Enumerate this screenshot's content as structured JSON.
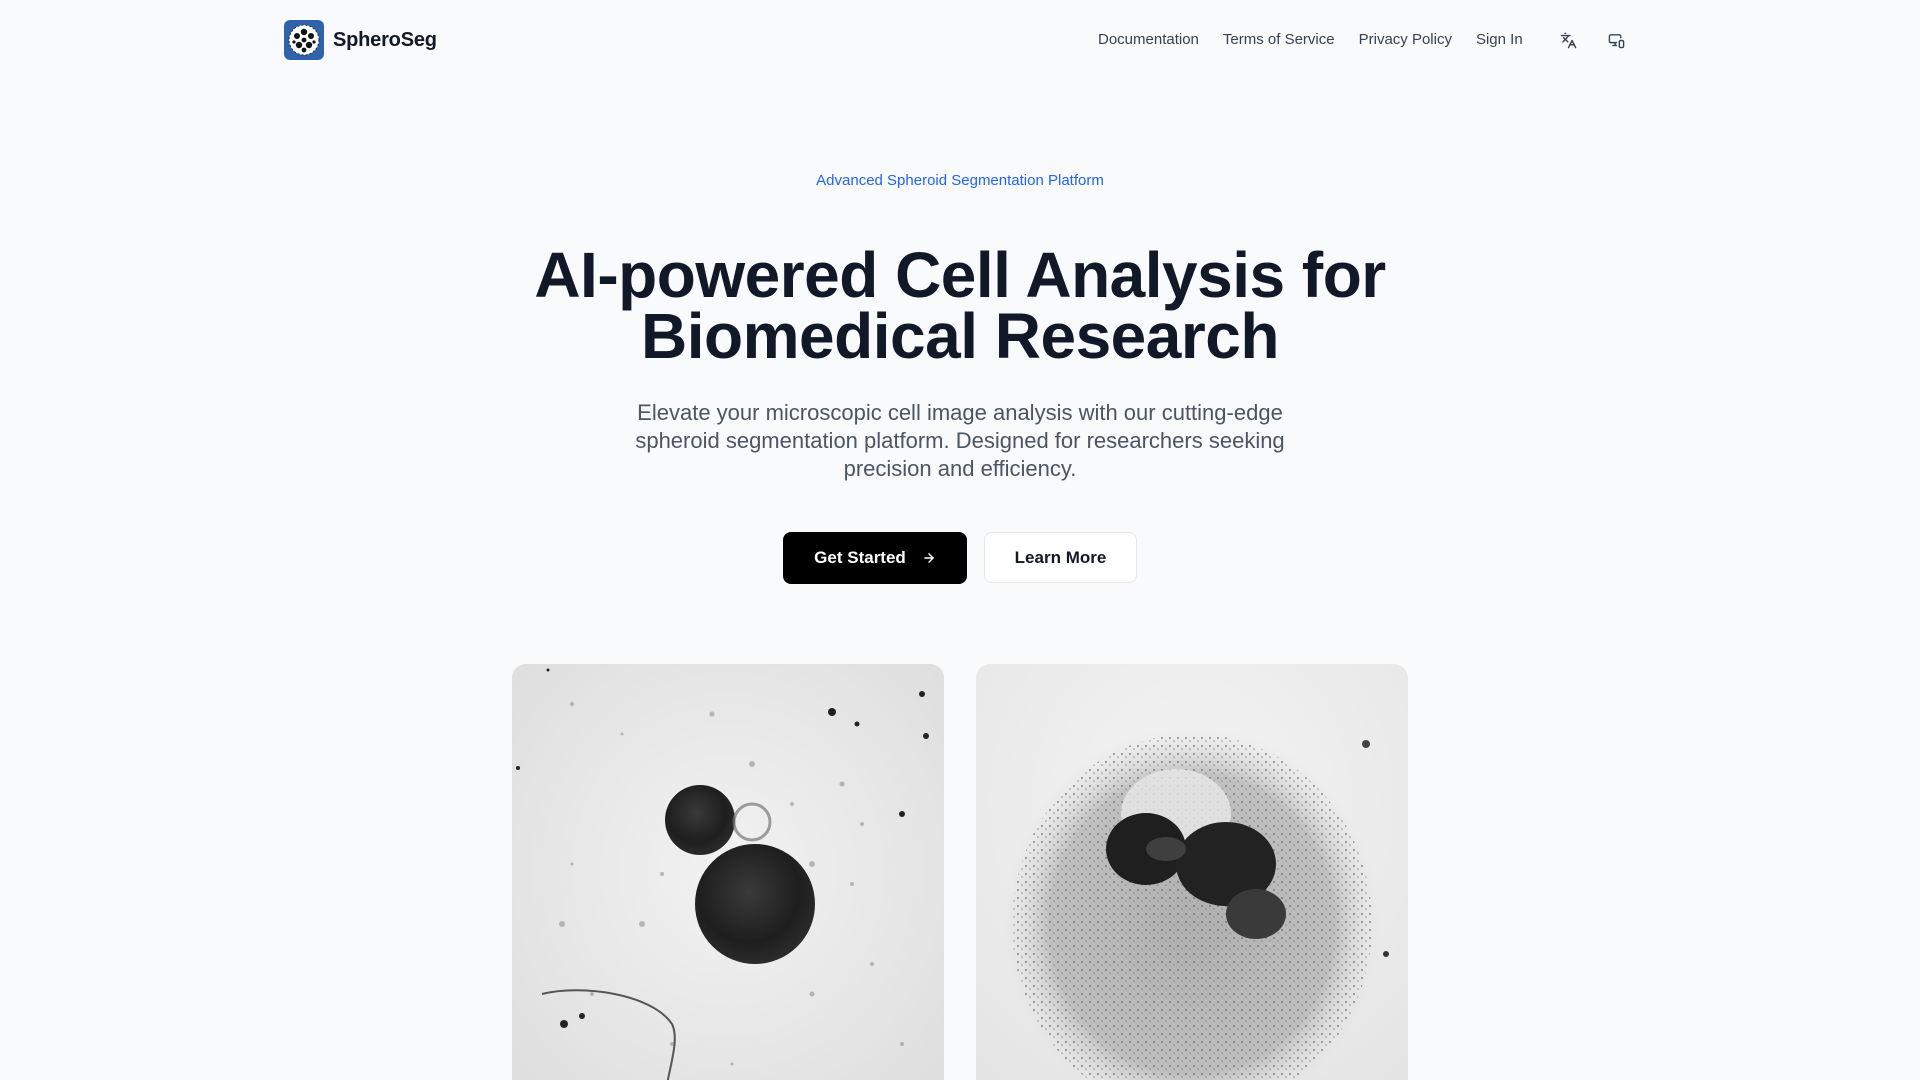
{
  "brand": {
    "name": "SpheroSeg",
    "color": "#2f64ad"
  },
  "nav": {
    "links": [
      "Documentation",
      "Terms of Service",
      "Privacy Policy",
      "Sign In"
    ],
    "icons": [
      "translate-icon",
      "theme-toggle-icon"
    ]
  },
  "hero": {
    "eyebrow": "Advanced Spheroid Segmentation Platform",
    "title_line1": "AI-powered Cell Analysis for",
    "title_line2": "Biomedical Research",
    "subtitle": "Elevate your microscopic cell image analysis with our cutting-edge spheroid segmentation platform. Designed for researchers seeking precision and efficiency.",
    "primary_cta": "Get Started",
    "secondary_cta": "Learn More"
  },
  "colors": {
    "accent": "#2563eb",
    "background": "#f8fafc",
    "text": "#111827"
  }
}
